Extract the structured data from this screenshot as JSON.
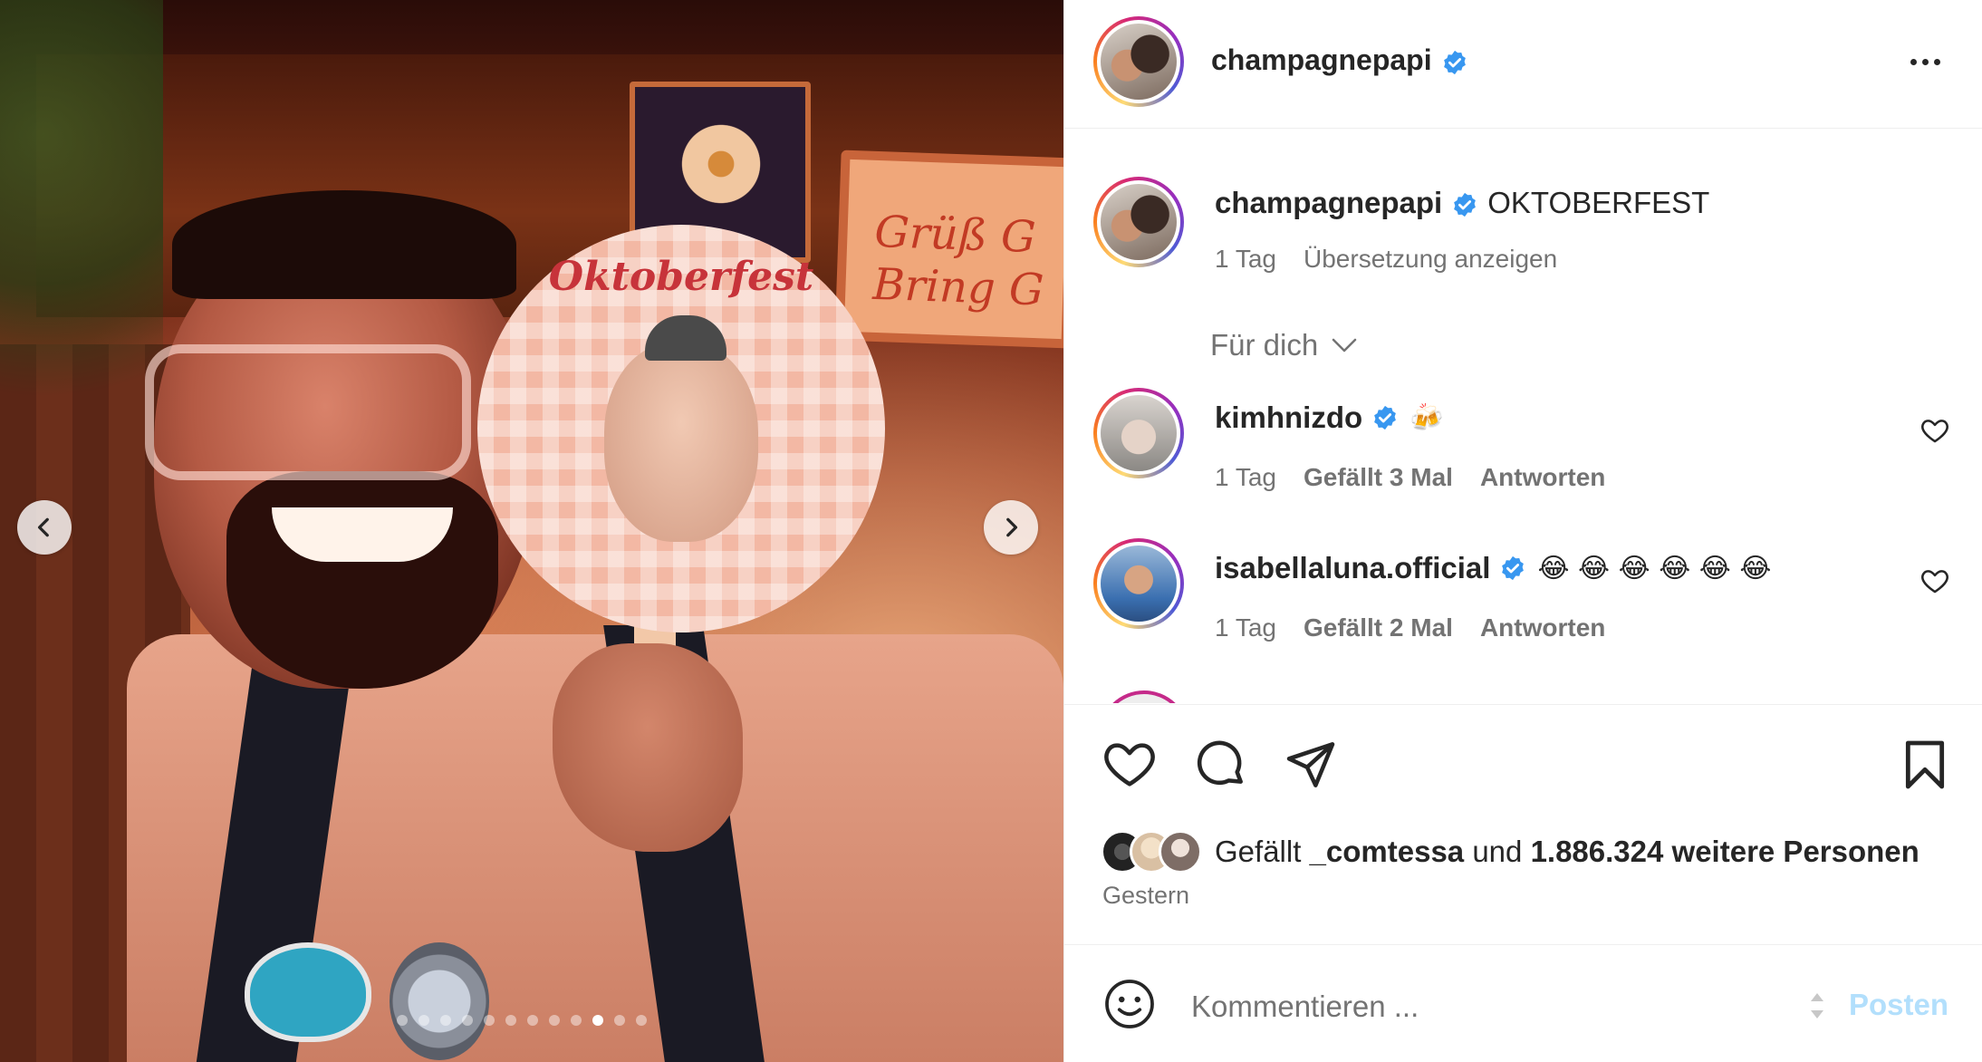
{
  "post": {
    "author": "champagnepapi",
    "media_dots": {
      "count": 12,
      "active_index": 9
    },
    "fan_text": "Oktoberfest",
    "sign_text": "Grüß G\nBring G"
  },
  "caption": {
    "username": "champagnepapi",
    "text": "OKTOBERFEST",
    "age": "1 Tag",
    "translate_link": "Übersetzung anzeigen"
  },
  "comments_filter": {
    "label": "Für dich"
  },
  "comments": [
    {
      "username": "kimhnizdo",
      "text": "🍻",
      "age": "1 Tag",
      "likes": "Gefällt 3 Mal",
      "reply": "Antworten"
    },
    {
      "username": "isabellaluna.official",
      "text": "😂 😂 😂 😂 😂 😂",
      "age": "1 Tag",
      "likes": "Gefällt 2 Mal",
      "reply": "Antworten"
    }
  ],
  "likes": {
    "prefix": "Gefällt",
    "user": "_comtessa",
    "conjunction": "und",
    "others": "1.886.324 weitere Personen"
  },
  "date": "Gestern",
  "composer": {
    "placeholder": "Kommentieren ...",
    "post_label": "Posten"
  },
  "icons": {
    "verified": "verified-badge-icon",
    "like": "heart-icon",
    "comment": "comment-bubble-icon",
    "share": "paper-plane-icon",
    "save": "bookmark-icon",
    "emoji": "smiley-icon",
    "more": "more-horizontal-icon",
    "prev": "chevron-left-icon",
    "next": "chevron-right-icon"
  },
  "colors": {
    "verified_blue": "#3897f0",
    "post_button_disabled": "#b2dffc",
    "secondary_text": "#737373"
  }
}
